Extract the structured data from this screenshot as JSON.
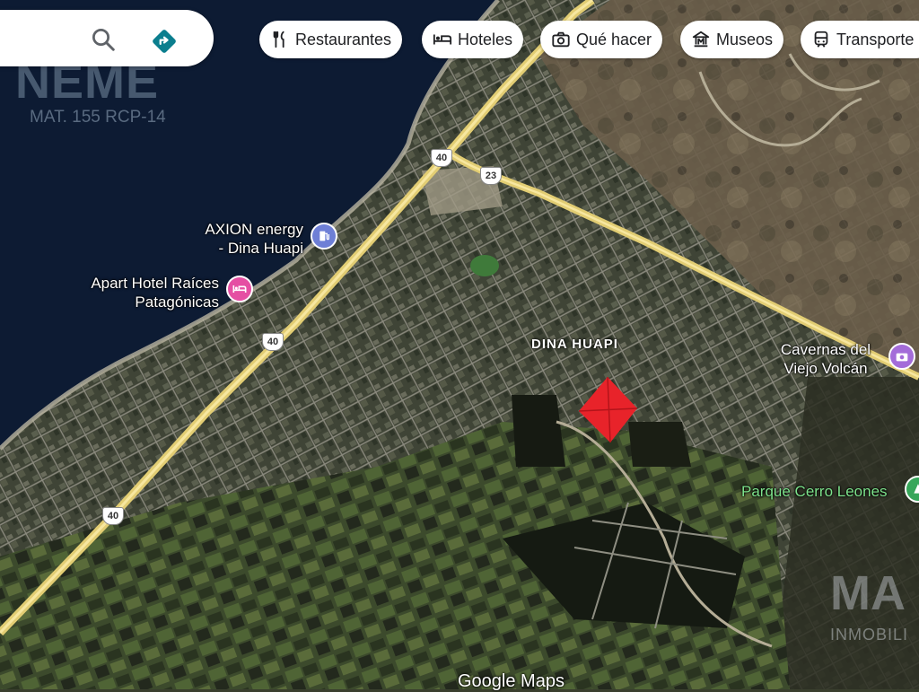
{
  "search": {
    "value": ""
  },
  "chips": [
    {
      "label": "Restaurantes",
      "icon": "fork-knife-icon"
    },
    {
      "label": "Hoteles",
      "icon": "bed-icon"
    },
    {
      "label": "Qué hacer",
      "icon": "camera-icon"
    },
    {
      "label": "Museos",
      "icon": "museum-icon"
    },
    {
      "label": "Transporte",
      "icon": "train-icon"
    }
  ],
  "watermark": {
    "title": "NEME",
    "subtitle": "MAT. 155 RCP-14"
  },
  "watermark2": {
    "title": "MA",
    "subtitle": "INMOBILI"
  },
  "places": {
    "axion_line1": "AXION energy",
    "axion_line2": "- Dina Huapi",
    "hotel_line1": "Apart Hotel Raíces",
    "hotel_line2": "Patagónicas",
    "cavernas_line1": "Cavernas del",
    "cavernas_line2": "Viejo Volcán",
    "parque": "Parque Cerro Leones"
  },
  "area_label": "DINA HUAPI",
  "road_shields": [
    "40",
    "23",
    "40",
    "40"
  ],
  "attribution": "Google Maps",
  "colors": {
    "lake": "#0d1b33",
    "marker": "#e8232a",
    "fuel_pin": "#6e7fd6",
    "hotel_pin": "#e54fa3",
    "attraction_pin": "#a46cd9",
    "park_pin": "#37a65a"
  }
}
